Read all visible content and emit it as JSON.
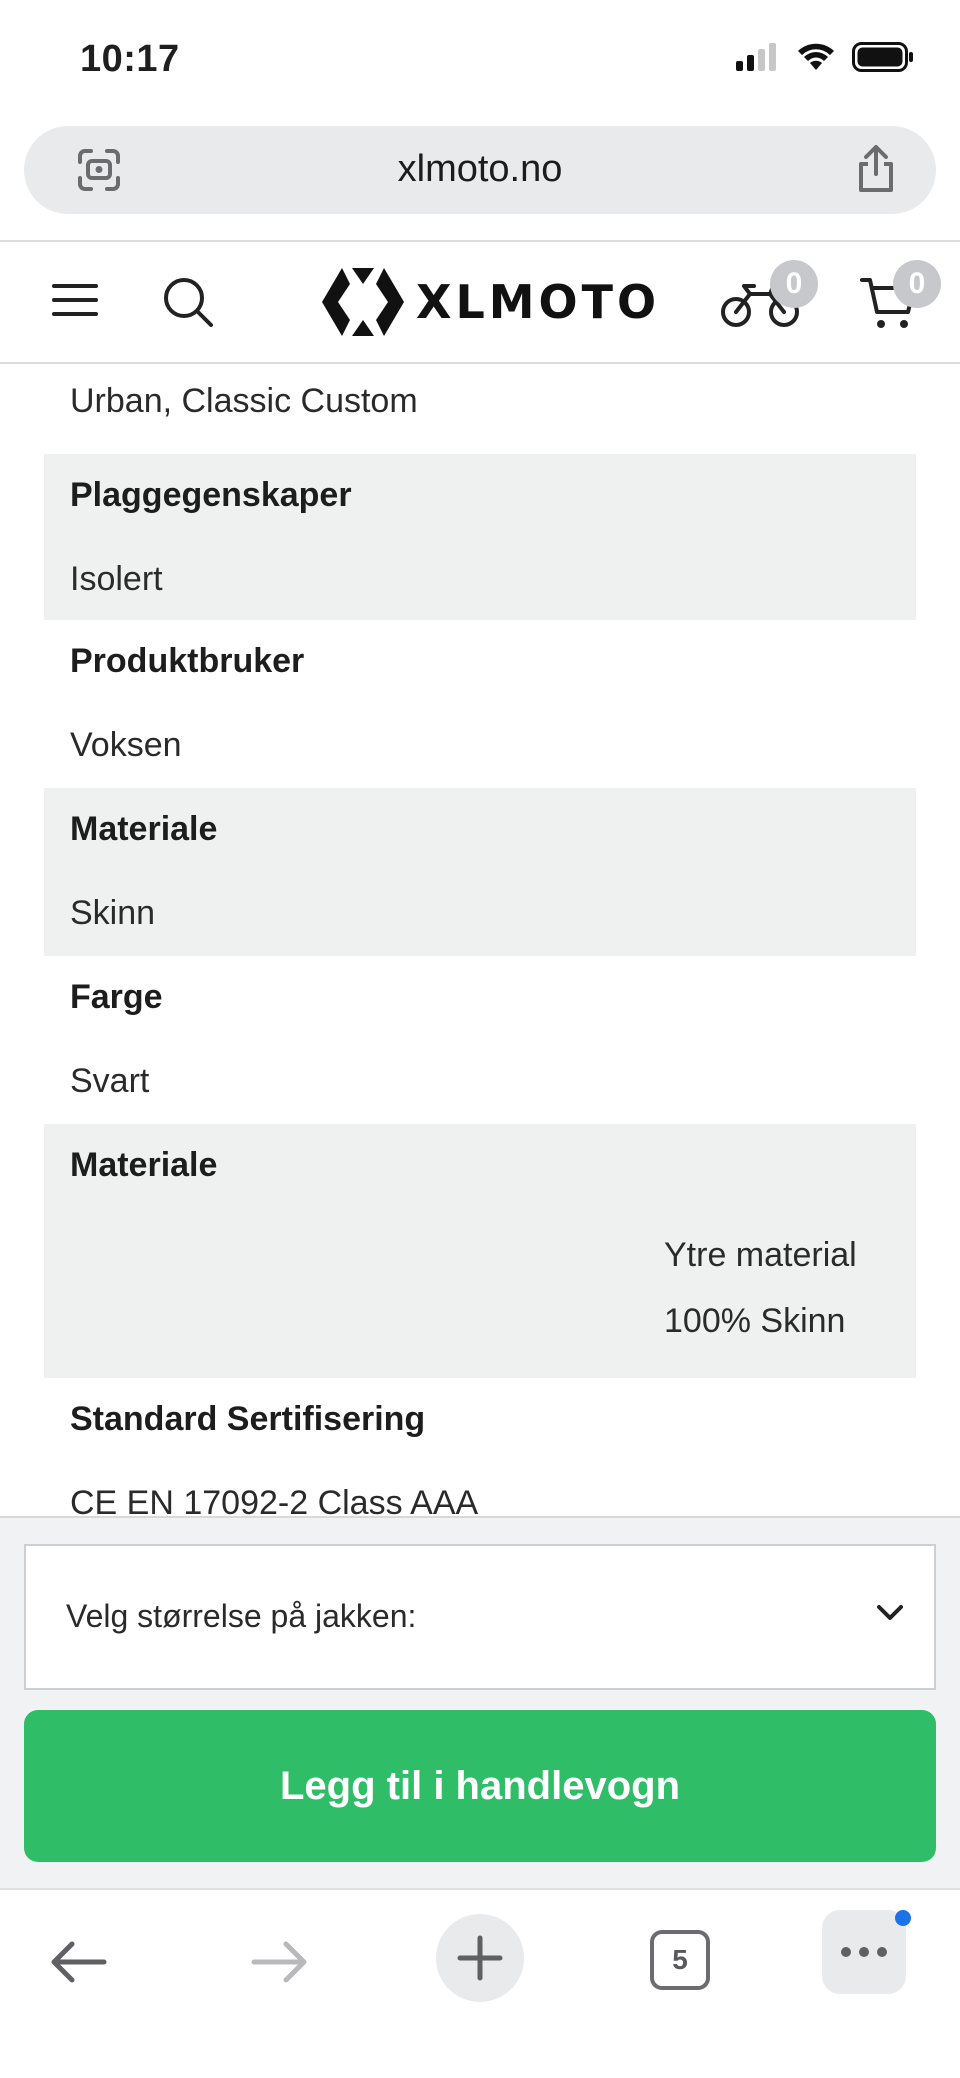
{
  "status_bar": {
    "time": "10:17"
  },
  "address_bar": {
    "url": "xlmoto.no"
  },
  "header": {
    "logo_text": "XLMOTO",
    "garage_count": "0",
    "cart_count": "0"
  },
  "specs": {
    "top_value": "Urban, Classic Custom",
    "rows": [
      {
        "label": "Plaggegenskaper",
        "value": "Isolert"
      },
      {
        "label": "Produktbruker",
        "value": "Voksen"
      },
      {
        "label": "Materiale",
        "value": "Skinn"
      },
      {
        "label": "Farge",
        "value": "Svart"
      },
      {
        "label": "Materiale",
        "value_line1": "Ytre material",
        "value_line2": "100% Skinn"
      },
      {
        "label": "Standard Sertifisering",
        "value": "CE EN 17092-2 Class AAA"
      }
    ]
  },
  "purchase": {
    "size_select_label": "Velg størrelse på jakken:",
    "add_to_cart_label": "Legg til i handlevogn",
    "accent_color": "#2fbd68"
  },
  "toolbar": {
    "tab_count": "5"
  }
}
